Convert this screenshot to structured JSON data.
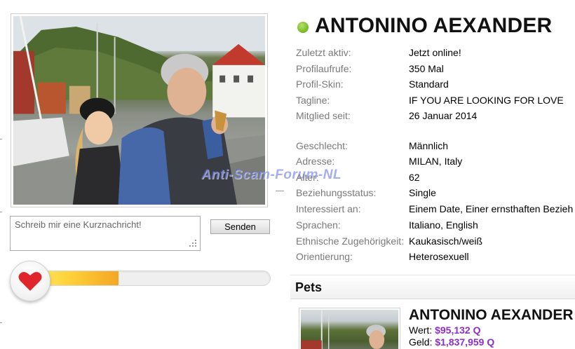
{
  "profile": {
    "name": "ANTONINO AEXANDER",
    "status_color": "#7cbf2a",
    "rows": [
      {
        "label": "Zuletzt aktiv:",
        "value": "Jetzt online!"
      },
      {
        "label": "Profilaufrufe:",
        "value": "350 Mal"
      },
      {
        "label": "Profil-Skin:",
        "value": "Standard"
      },
      {
        "label": "Tagline:",
        "value": "IF YOU ARE LOOKING FOR LOVE"
      },
      {
        "label": "Mitglied seit:",
        "value": "26 Januar 2014"
      },
      {
        "label": "Geschlecht:",
        "value": "Männlich"
      },
      {
        "label": "Adresse:",
        "value": "MILAN, Italy"
      },
      {
        "label": "Alter:",
        "value": "62"
      },
      {
        "label": "Beziehungsstatus:",
        "value": "Single"
      },
      {
        "label": "Interessiert an:",
        "value": "Einem Date, Einer ernsthaften Bezieh"
      },
      {
        "label": "Sprachen:",
        "value": "Italiano, English"
      },
      {
        "label": "Ethnische Zugehörigkeit:",
        "value": "Kaukasisch/weiß"
      },
      {
        "label": "Orientierung:",
        "value": "Heterosexuell"
      }
    ]
  },
  "photo": {
    "watermark": "Anti-Scam-Forum-NL"
  },
  "message": {
    "placeholder": "Schreib mir eine Kurznachricht!",
    "send_label": "Senden"
  },
  "meter": {
    "level_percent": 38,
    "fill_color": "#f5a623",
    "heart_color": "#e0262c",
    "icon": "heart-icon"
  },
  "pets": {
    "title": "Pets",
    "card": {
      "name": "ANTONINO AEXANDER",
      "worth_label": "Wert:",
      "worth_value": "$95,132 Q",
      "cash_label": "Geld:",
      "cash_value": "$1,837,959 Q",
      "value_color": "#8b2fc9"
    }
  }
}
